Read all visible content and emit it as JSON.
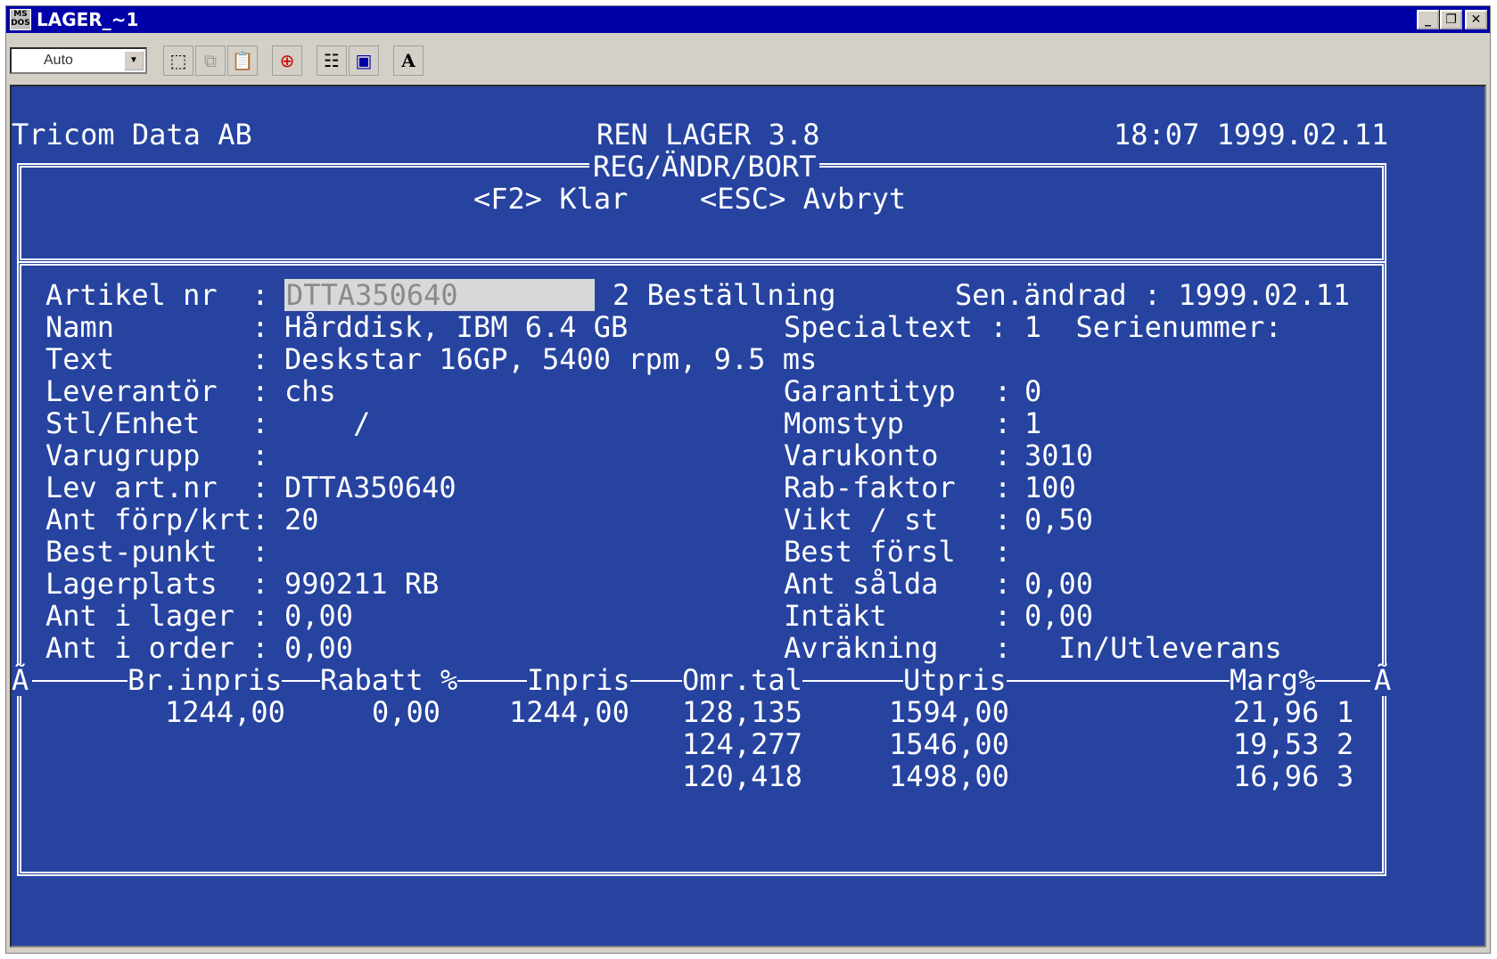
{
  "window": {
    "title": "LAGER_~1",
    "app_icon_text": "MS DOS",
    "controls": {
      "minimize": "_",
      "restore": "❐",
      "close": "✕"
    }
  },
  "toolbar": {
    "font_combo": "Auto",
    "buttons": [
      {
        "name": "mark-icon",
        "glyph": "⬚"
      },
      {
        "name": "copy-icon",
        "glyph": "⧉"
      },
      {
        "name": "paste-icon",
        "glyph": "📋"
      },
      {
        "name": "fullscreen-icon",
        "glyph": "⊕"
      },
      {
        "name": "properties-icon",
        "glyph": "☷"
      },
      {
        "name": "background-icon",
        "glyph": "▣"
      },
      {
        "name": "font-icon",
        "glyph": "A"
      }
    ]
  },
  "screen": {
    "company": "Tricom Data AB",
    "program": "REN LAGER 3.8",
    "datetime": "18:07 1999.02.11",
    "mode": "REG/ÄNDR/BORT",
    "key_done": "<F2> Klar",
    "key_abort": "<ESC> Avbryt",
    "artikel_label": "Artikel nr  :",
    "artikel_value": "DTTA350640",
    "bestallning": "2 Beställning",
    "sen_andrad": "Sen.ändrad : 1999.02.11",
    "left_fields": [
      {
        "label": "Namn        :",
        "value": "Hårddisk, IBM 6.4 GB"
      },
      {
        "label": "Text        :",
        "value": "Deskstar 16GP, 5400 rpm, 9.5 ms"
      },
      {
        "label": "Leverantör  :",
        "value": "chs"
      },
      {
        "label": "Stl/Enhet   :",
        "value": "    /"
      },
      {
        "label": "Varugrupp   :",
        "value": ""
      },
      {
        "label": "Lev art.nr  :",
        "value": "DTTA350640"
      },
      {
        "label": "Ant förp/krt:",
        "value": "20"
      },
      {
        "label": "Best-punkt  :",
        "value": ""
      },
      {
        "label": "Lagerplats  :",
        "value": "990211 RB"
      },
      {
        "label": "Ant i lager :",
        "value": "0,00"
      },
      {
        "label": "Ant i order :",
        "value": "0,00"
      }
    ],
    "specialtext": "Specialtext : 1  Serienummer:",
    "right_fields": [
      {
        "label": "Garantityp",
        "value": "0"
      },
      {
        "label": "Momstyp",
        "value": "1"
      },
      {
        "label": "Varukonto",
        "value": "3010"
      },
      {
        "label": "Rab-faktor",
        "value": "100"
      },
      {
        "label": "Vikt / st",
        "value": "0,50"
      },
      {
        "label": "Best försl",
        "value": ""
      },
      {
        "label": "Ant sålda",
        "value": "0,00"
      },
      {
        "label": "Intäkt",
        "value": "0,00"
      },
      {
        "label": "Avräkning",
        "value": " In/Utleverans"
      }
    ],
    "border_char": "Ã",
    "price_headers": [
      "Br.inpris",
      "Rabatt %",
      "Inpris",
      "Omr.tal",
      "Utpris",
      "Marg%"
    ],
    "price_first": {
      "br_inpris": "1244,00",
      "rabatt": "0,00",
      "inpris": "1244,00"
    },
    "price_rows": [
      {
        "omr_tal": "128,135",
        "utpris": "1594,00",
        "marg": "21,96",
        "nr": "1"
      },
      {
        "omr_tal": "124,277",
        "utpris": "1546,00",
        "marg": "19,53",
        "nr": "2"
      },
      {
        "omr_tal": "120,418",
        "utpris": "1498,00",
        "marg": "16,96",
        "nr": "3"
      }
    ]
  }
}
